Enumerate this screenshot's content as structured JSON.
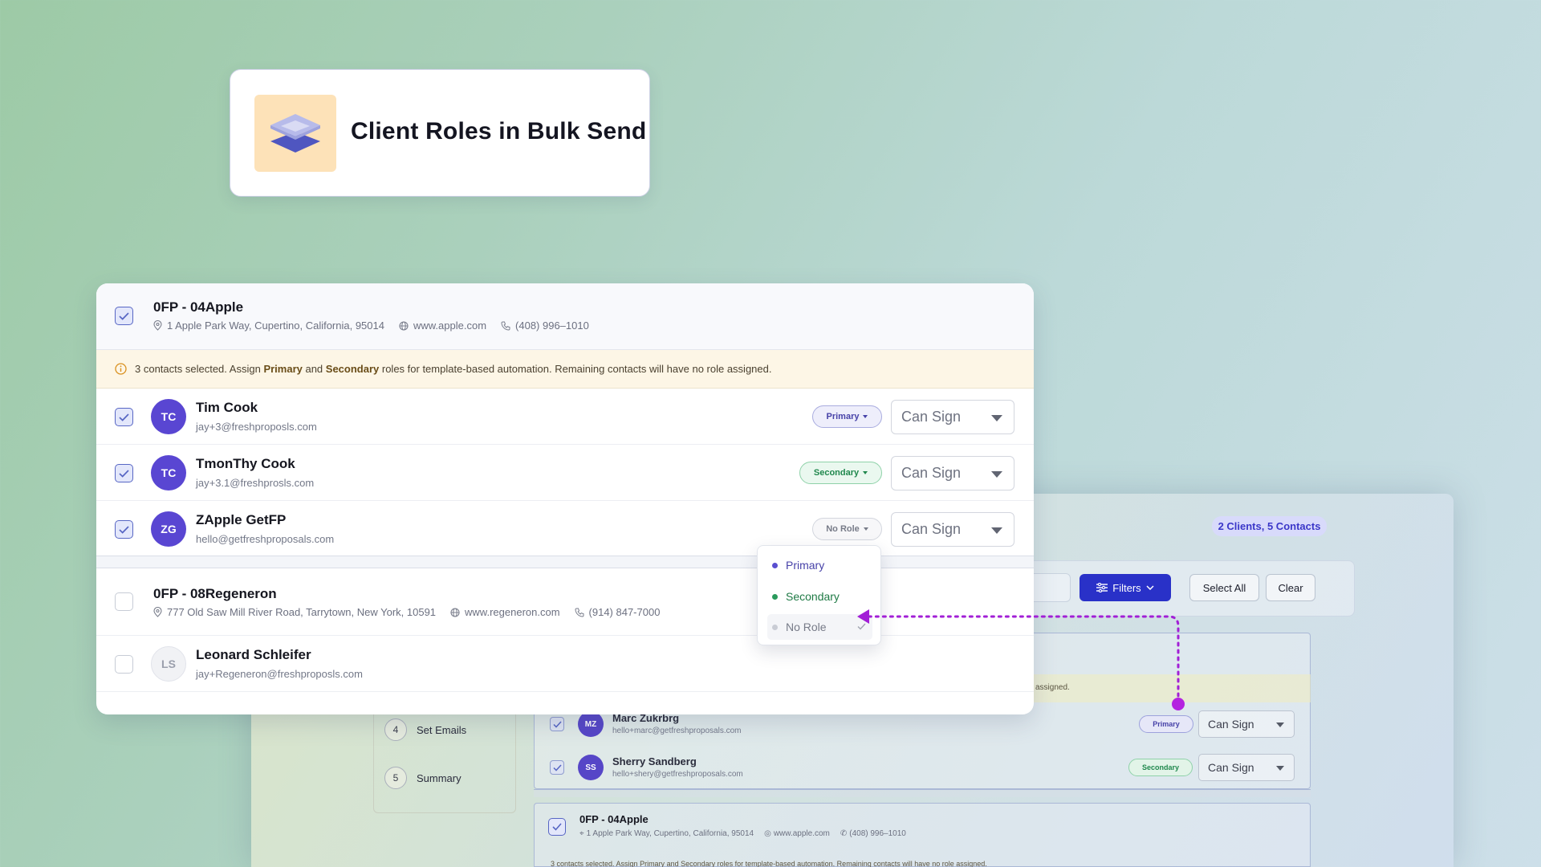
{
  "title_card": {
    "title": "Client Roles in Bulk Send"
  },
  "bg_window": {
    "count_badge": "2 Clients, 5 Contacts",
    "filters_label": "Filters",
    "select_all_label": "Select All",
    "clear_label": "Clear",
    "notice_tail": "assigned.",
    "steps": [
      {
        "num": "4",
        "label": "Set Emails"
      },
      {
        "num": "5",
        "label": "Summary"
      }
    ],
    "contacts": [
      {
        "initials": "MZ",
        "name": "Marc Zukrbrg",
        "email": "hello+marc@getfreshproposals.com",
        "role": "Primary",
        "permission": "Can Sign"
      },
      {
        "initials": "SS",
        "name": "Sherry Sandberg",
        "email": "hello+shery@getfreshproposals.com",
        "role": "Secondary",
        "permission": "Can Sign"
      }
    ],
    "client2": {
      "name": "0FP - 04Apple",
      "address": "1 Apple Park Way, Cupertino, California, 95014",
      "website": "www.apple.com",
      "phone": "(408) 996–1010",
      "notice_partial": "3 contacts selected. Assign Primary and Secondary roles for template-based automation. Remaining contacts will have no role assigned."
    }
  },
  "clients": [
    {
      "name": "0FP - 04Apple",
      "address": "1 Apple Park Way, Cupertino, California, 95014",
      "website": "www.apple.com",
      "phone": "(408) 996–1010",
      "selected": true,
      "notice": {
        "pre": "3 contacts selected. Assign ",
        "b1": "Primary",
        "mid": " and ",
        "b2": "Secondary",
        "post": " roles for template-based automation. Remaining contacts will have no role assigned."
      },
      "contacts": [
        {
          "initials": "TC",
          "name": "Tim Cook",
          "email": "jay+3@freshproposls.com",
          "role": "Primary",
          "permission": "Can Sign",
          "selected": true
        },
        {
          "initials": "TC",
          "name": "TmonThy Cook",
          "email": "jay+3.1@freshprosls.com",
          "role": "Secondary",
          "permission": "Can Sign",
          "selected": true
        },
        {
          "initials": "ZG",
          "name": "ZApple GetFP",
          "email": "hello@getfreshproposals.com",
          "role": "No Role",
          "permission": "Can Sign",
          "selected": true
        }
      ]
    },
    {
      "name": "0FP - 08Regeneron",
      "address": "777 Old Saw Mill River Road, Tarrytown, New York, 10591",
      "website": "www.regeneron.com",
      "phone": "(914) 847-7000",
      "selected": false,
      "contacts": [
        {
          "initials": "LS",
          "name": "Leonard Schleifer",
          "email": "jay+Regeneron@freshproposls.com",
          "selected": false
        }
      ]
    }
  ],
  "role_dropdown": {
    "options": [
      {
        "label": "Primary",
        "color": "#5a4fd0"
      },
      {
        "label": "Secondary",
        "color": "#2a9a5c"
      },
      {
        "label": "No Role",
        "color": "#c9ccd4",
        "selected": true
      }
    ]
  },
  "colors": {
    "accent": "#5946d2",
    "primary_pill": "#4742a8",
    "secondary_pill": "#20884d",
    "connector": "#a21fd6",
    "filters_button": "#2931c8"
  },
  "icons": [
    "layers-logo-icon",
    "location-pin-icon",
    "globe-icon",
    "phone-icon",
    "info-icon",
    "check-icon",
    "filter-sliders-icon",
    "chevron-down-icon"
  ]
}
